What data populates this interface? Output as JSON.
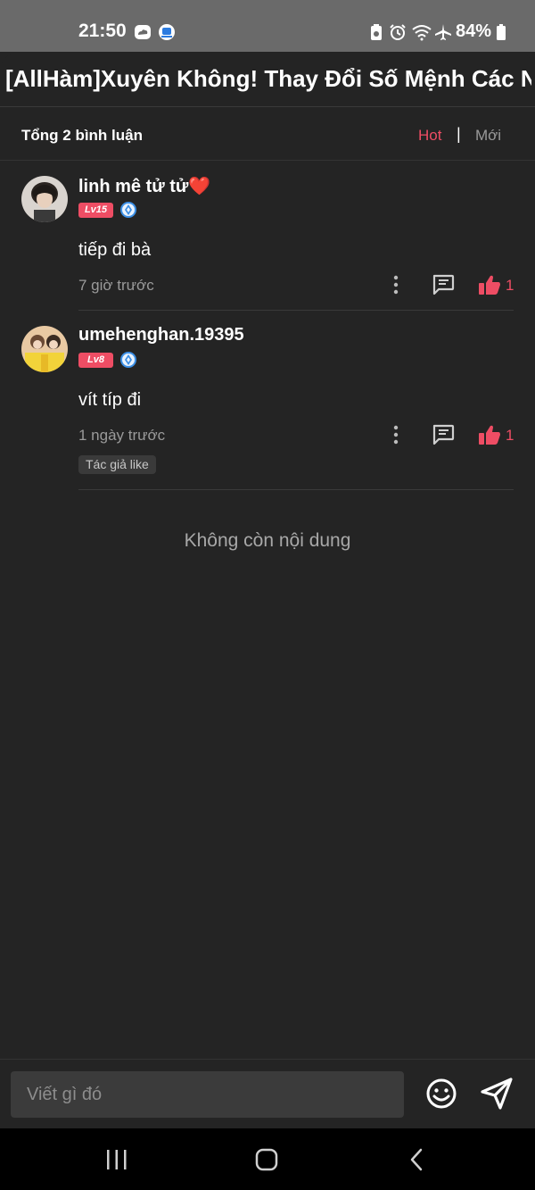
{
  "status_bar": {
    "time": "21:50",
    "battery": "84%",
    "icons": [
      "cloud-icon",
      "app-icon",
      "battery-saver-icon",
      "alarm-icon",
      "wifi-icon",
      "airplane-icon",
      "battery-icon"
    ]
  },
  "header": {
    "title": "[AllHàm]Xuyên Không! Thay Đổi Số Mệnh Các N..."
  },
  "comments_header": {
    "total": "Tổng 2 bình luận",
    "sort_hot": "Hot",
    "sort_divider": "|",
    "sort_new": "Mới"
  },
  "comments": [
    {
      "username": "linh mê tử tử❤️",
      "level": "Lv15",
      "text": "tiếp đi bà",
      "time": "7 giờ trước",
      "likes": "1"
    },
    {
      "username": "umehenghan.19395",
      "level": "Lv8",
      "text": "vít típ đi",
      "time": "1 ngày trước",
      "likes": "1",
      "tag": "Tác giả like"
    }
  ],
  "end_message": "Không còn nội dung",
  "composer": {
    "placeholder": "Viết gì đó"
  },
  "colors": {
    "accent": "#ee4d64",
    "background": "#242424",
    "muted_text": "#9a9a9a"
  }
}
